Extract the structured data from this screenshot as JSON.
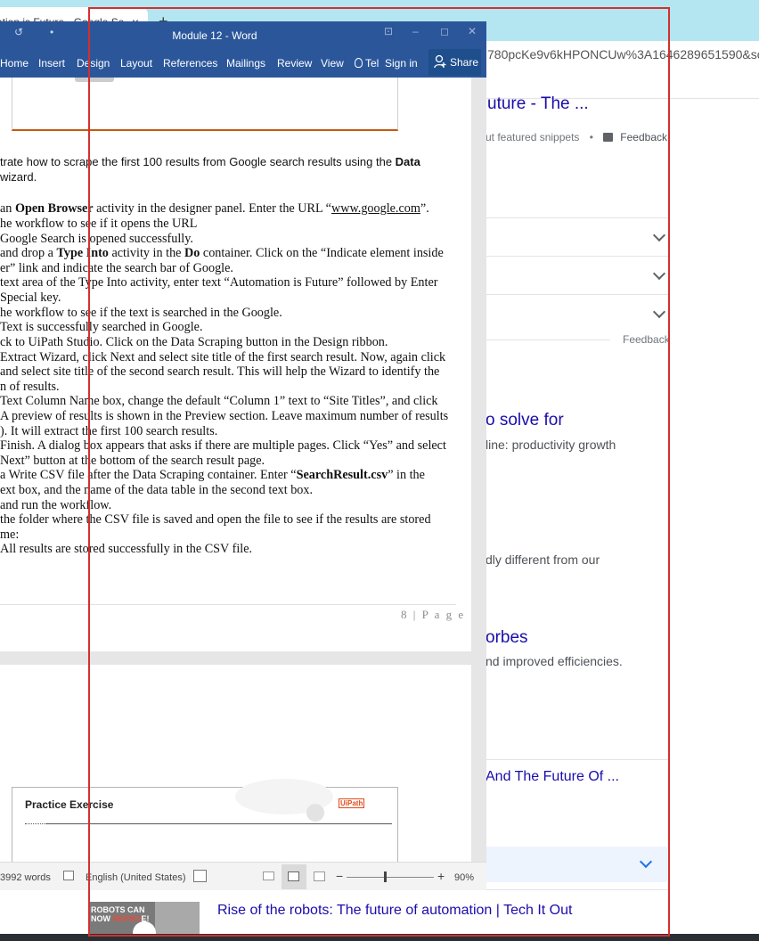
{
  "browser": {
    "tab_title": "ation is Future - Google Se",
    "tab_close": "×",
    "new_tab": "+",
    "url": "780pcKe9v6kHPONCUw%3A1646289651590&sou",
    "results": [
      {
        "title": "uture - The ..."
      },
      {
        "snippet_label": "ut featured snippets",
        "dot": "•",
        "feedback": "Feedback"
      },
      {
        "feedback": "Feedback"
      },
      {
        "title": "o solve for",
        "snippet": "line: productivity growth"
      },
      {
        "snippet": "dly different from our"
      },
      {
        "title": "orbes",
        "snippet": "nd improved efficiencies."
      },
      {
        "title": "And The Future Of ..."
      },
      {
        "title": "Rise of the robots: The future of automation | Tech It Out"
      }
    ],
    "video_thumb": {
      "line1": "ROBOTS CAN",
      "line2_a": "NOW ",
      "line2_b": "REPRO",
      "line2_c": "E!"
    }
  },
  "word": {
    "title": "Module 12 - Word",
    "quick_access": [
      "↺",
      "•"
    ],
    "window_controls": [
      "⊡",
      "–",
      "◻",
      "✕"
    ],
    "ribbon_tabs": [
      "Home",
      "Insert",
      "Design",
      "Layout",
      "References",
      "Mailings",
      "Review",
      "View"
    ],
    "tell_me": "Tel",
    "sign_in": "Sign in",
    "share": "Share",
    "doc_lines": [
      {
        "text": "trate how to scrape the first 100 results from Google search results using the ",
        "bold": "Data"
      },
      {
        "text": " wizard."
      },
      {
        "pre": "an ",
        "bold": "Open Browser",
        "post": " activity in the designer panel. Enter the URL “",
        "underline": "www.google.com",
        "tail": "”."
      },
      {
        "text": "he workflow to see if it opens the URL"
      },
      {
        "text": "   Google Search is opened successfully."
      },
      {
        "pre": "and drop a ",
        "bold": "Type Into",
        "post": " activity in the ",
        "bold2": "Do",
        "tail": " container. Click on the “Indicate element inside"
      },
      {
        "text": "er” link and indicate the search bar of Google."
      },
      {
        "text": " text area of the Type Into activity, enter text “Automation is Future” followed by Enter"
      },
      {
        "text": " Special key."
      },
      {
        "text": "he workflow to see if the text is searched in the Google."
      },
      {
        "text": "   Text is successfully searched in Google."
      },
      {
        "text": "ck to UiPath Studio. Click on the Data Scraping button in the Design ribbon."
      },
      {
        "text": " Extract Wizard, click Next and select site title of the first search result. Now, again click"
      },
      {
        "text": "and select site title of the second search result. This will help the Wizard to identify the"
      },
      {
        "text": "n of results."
      },
      {
        "text": " Text Column Name box, change the default “Column 1” text to “Site Titles”, and click"
      },
      {
        "text": "A preview of results is shown in the Preview section. Leave maximum number of results"
      },
      {
        "text": "). It will extract the first 100 search results."
      },
      {
        "text": " Finish. A dialog box appears that asks if there are multiple pages. Click “Yes” and select"
      },
      {
        "text": "Next” button at the bottom of the search result page."
      },
      {
        "pre": "a Write CSV file after the Data Scraping container. Enter “",
        "bold": "SearchResult.csv",
        "post": "” in the"
      },
      {
        "text": "ext box, and the name of the data table in the second text box."
      },
      {
        "text": "and run the workflow."
      },
      {
        "text": " the folder where the CSV file is saved and open the file to see if the results are stored"
      },
      {
        "text": "me:"
      },
      {
        "text": "   All results are stored successfully in the CSV file."
      }
    ],
    "page_number": "8 | P a g e",
    "practice_title": "Practice Exercise",
    "uipath_logo": "UiPath",
    "status": {
      "words": "3992 words",
      "language": "English (United States)",
      "zoom_minus": "−",
      "zoom_plus": "+",
      "zoom": "90%"
    }
  }
}
